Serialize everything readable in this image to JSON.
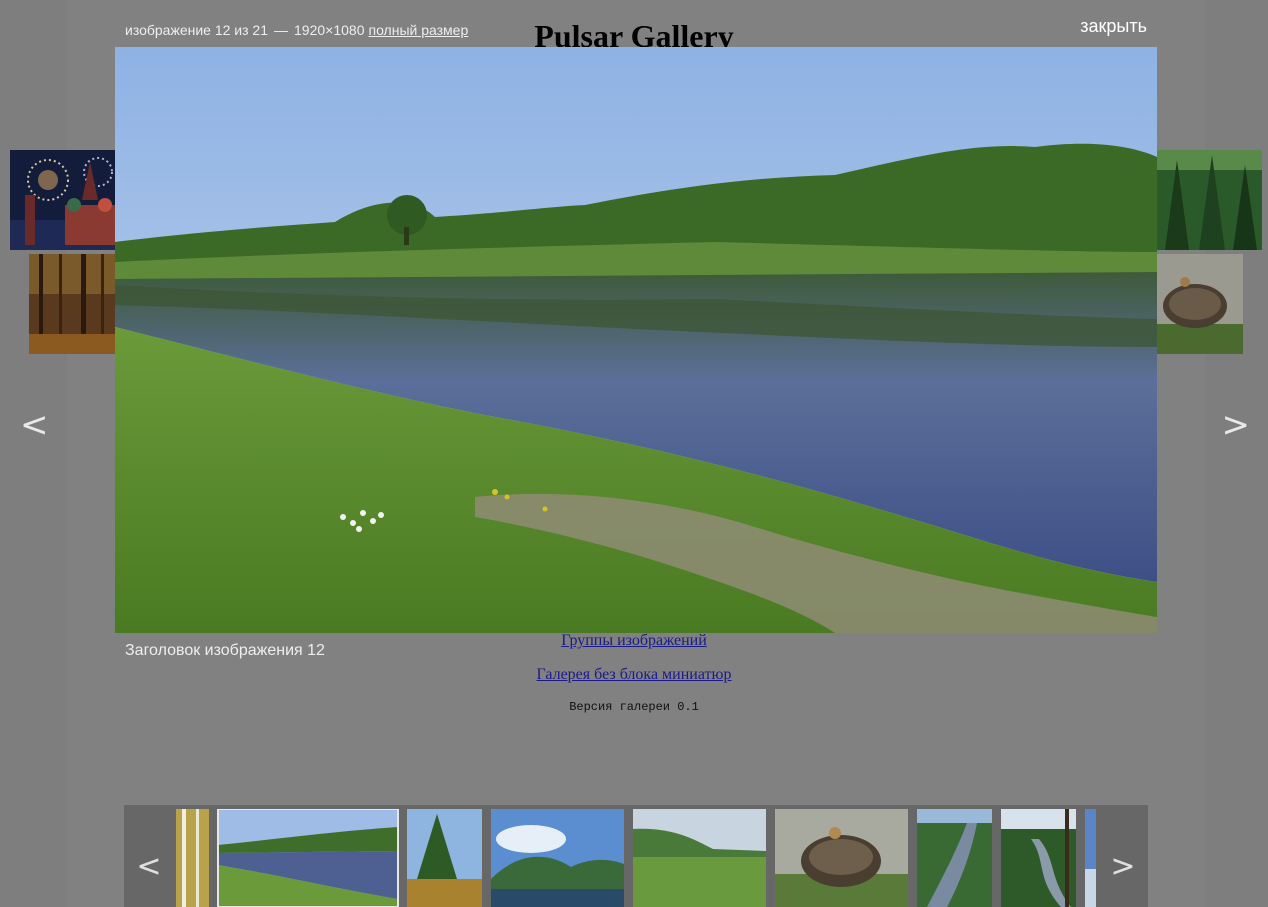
{
  "page": {
    "title": "Pulsar Gallery",
    "links": [
      "Группы изображений",
      "Галерея без блока миниатюр"
    ],
    "version": "Версия галереи 0.1"
  },
  "lightbox": {
    "counter": "изображение 12 из 21",
    "separator": "—",
    "resolution": "1920×1080",
    "full_size_label": "полный размер",
    "close_label": "закрыть",
    "caption": "Заголовок изображения 12",
    "prev_arrow": "<",
    "next_arrow": ">"
  },
  "filmstrip": {
    "prev_arrow": "<",
    "next_arrow": ">",
    "active_index": 1
  },
  "colors": {
    "overlay": "#7e7e7e",
    "filmstrip_bg": "#676767",
    "link": "#1a1a8c",
    "text_light": "#eeeeee"
  }
}
